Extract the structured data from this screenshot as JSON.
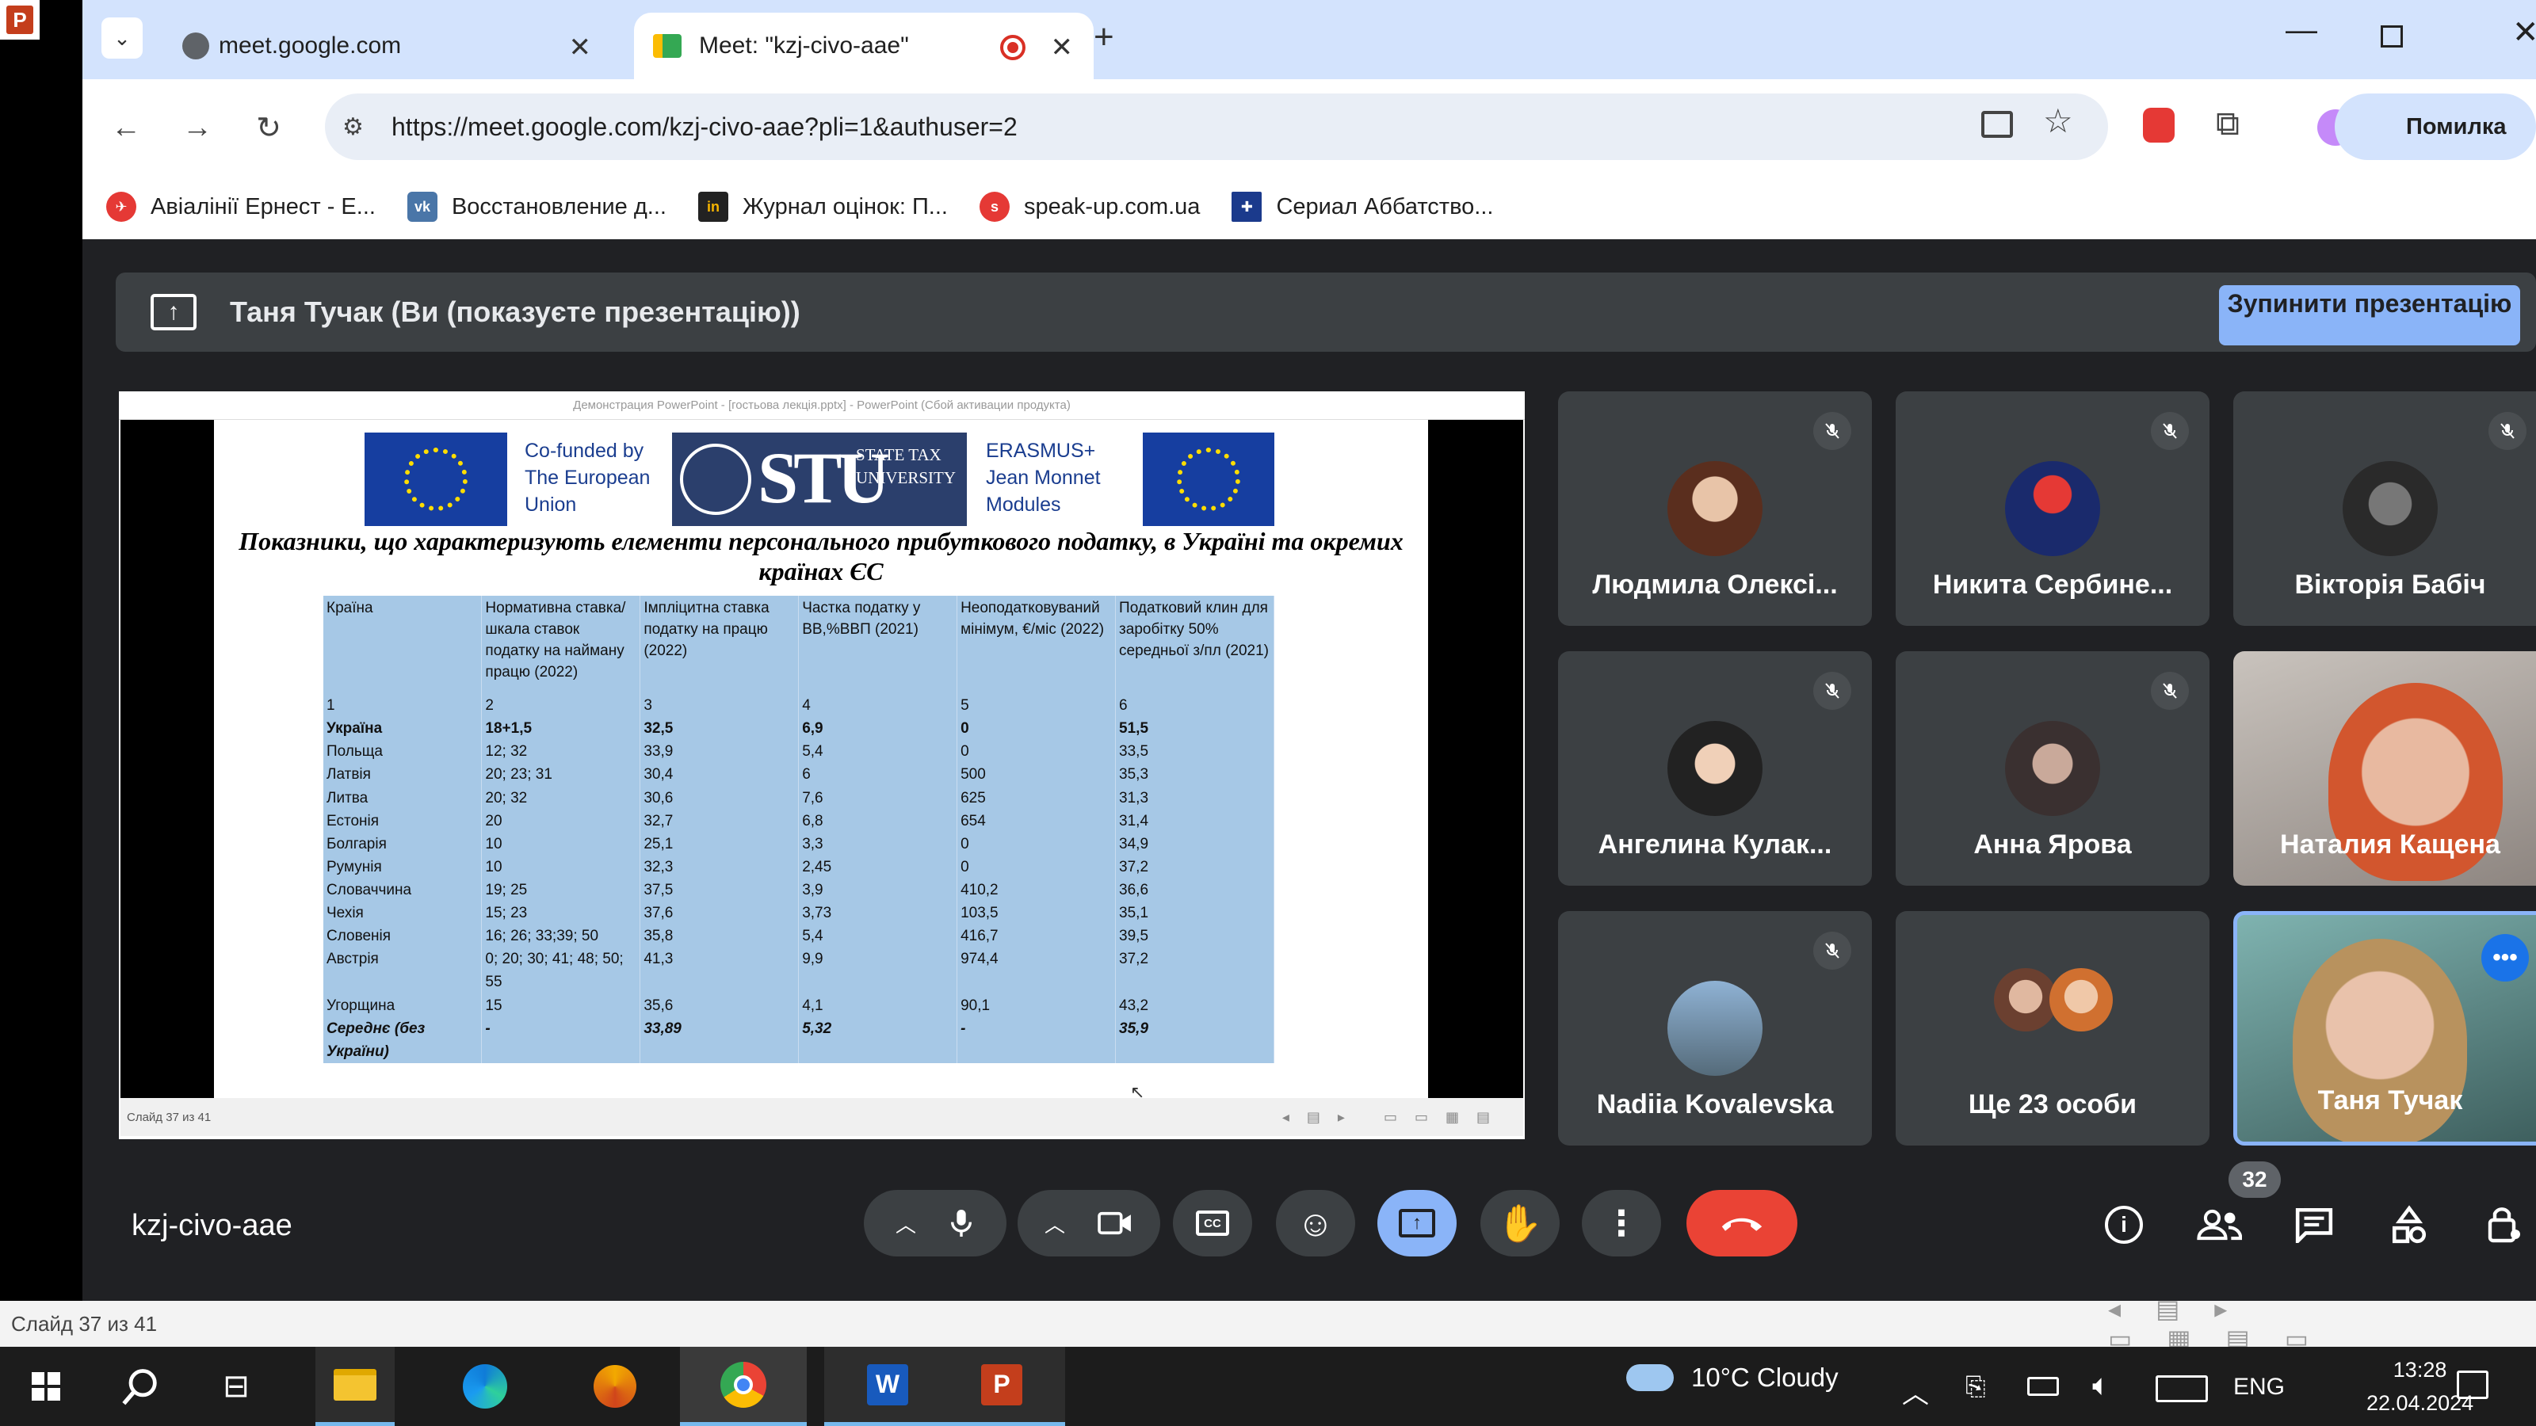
{
  "browser": {
    "tabs": [
      {
        "label": "meet.google.com"
      },
      {
        "label": "Meet: \"kzj-civo-aae\""
      }
    ],
    "url": "https://meet.google.com/kzj-civo-aae?pli=1&authuser=2",
    "profile_error": "Помилка",
    "bookmarks": [
      {
        "label": "Авіалінії Ернест - Е..."
      },
      {
        "label": "Восстановление д..."
      },
      {
        "label": "Журнал оцінок: П..."
      },
      {
        "label": "speak-up.com.ua"
      },
      {
        "label": "Сериал Аббатство..."
      }
    ]
  },
  "meet": {
    "presenting_text": "Таня Тучак (Ви (показуєте презентацію))",
    "stop_button": "Зупинити презентацію",
    "meeting_code": "kzj-civo-aae",
    "participant_count": "32",
    "participants": [
      {
        "name": "Людмила Олексі...",
        "muted": true
      },
      {
        "name": "Никита Сербине...",
        "muted": true
      },
      {
        "name": "Вікторія Бабіч",
        "muted": true
      },
      {
        "name": "Ангелина Кулак...",
        "muted": true
      },
      {
        "name": "Анна Ярова",
        "muted": true
      },
      {
        "name": "Наталия Кащена",
        "muted": false
      },
      {
        "name": "Nadiia Kovalevska",
        "muted": true
      },
      {
        "name": "Ще 23 особи",
        "muted": false
      },
      {
        "name": "Таня Тучак",
        "muted": false
      }
    ]
  },
  "slide": {
    "window_title": "Демонстрация PowerPoint - [гостьова лекція.pptx] - PowerPoint (Сбой активации продукта)",
    "cofunded": "Co-funded by The European Union",
    "stu": "STU",
    "stu_sub": "STATE TAX UNIVERSITY",
    "erasmus": "ERASMUS+ Jean Monnet Modules",
    "title": "Показники, що характеризують елементи персонального прибуткового податку, в Україні та окремих країнах ЄС",
    "status": "Слайд 37 из 41",
    "table_header": [
      "Країна",
      "Нормативна ставка/шкала ставок податку на найману працю (2022)",
      "Імпліцитна ставка податку на працю (2022)",
      "Частка податку у ВВ,%ВВП (2021)",
      "Неоподатковуваний мінімум, €/міс (2022)",
      "Податковий клин для заробітку 50% середньої з/пл (2021)"
    ],
    "table_rows": [
      [
        "1",
        "2",
        "3",
        "4",
        "5",
        "6"
      ],
      [
        "Україна",
        "18+1,5",
        "32,5",
        "6,9",
        "0",
        "51,5"
      ],
      [
        "Польща",
        "12; 32",
        "33,9",
        "5,4",
        "0",
        "33,5"
      ],
      [
        "Латвія",
        "20; 23; 31",
        "30,4",
        "6",
        "500",
        "35,3"
      ],
      [
        "Литва",
        "20; 32",
        "30,6",
        "7,6",
        "625",
        "31,3"
      ],
      [
        "Естонія",
        "20",
        "32,7",
        "6,8",
        "654",
        "31,4"
      ],
      [
        "Болгарія",
        "10",
        "25,1",
        "3,3",
        "0",
        "34,9"
      ],
      [
        "Румунія",
        "10",
        "32,3",
        "2,45",
        "0",
        "37,2"
      ],
      [
        "Словаччина",
        "19; 25",
        "37,5",
        "3,9",
        "410,2",
        "36,6"
      ],
      [
        "Чехія",
        "15; 23",
        "37,6",
        "3,73",
        "103,5",
        "35,1"
      ],
      [
        "Словенія",
        "16; 26; 33;39; 50",
        "35,8",
        "5,4",
        "416,7",
        "39,5"
      ],
      [
        "Австрія",
        "0; 20; 30; 41; 48; 50; 55",
        "41,3",
        "9,9",
        "974,4",
        "37,2"
      ],
      [
        "Угорщина",
        "15",
        "35,6",
        "4,1",
        "90,1",
        "43,2"
      ],
      [
        "Середнє (без України)",
        "-",
        "33,89",
        "5,32",
        "-",
        "35,9"
      ]
    ]
  },
  "ppt_status": "Слайд 37 из 41",
  "taskbar": {
    "weather": "10°C  Cloudy",
    "lang": "ENG",
    "time": "13:28",
    "date": "22.04.2024"
  }
}
